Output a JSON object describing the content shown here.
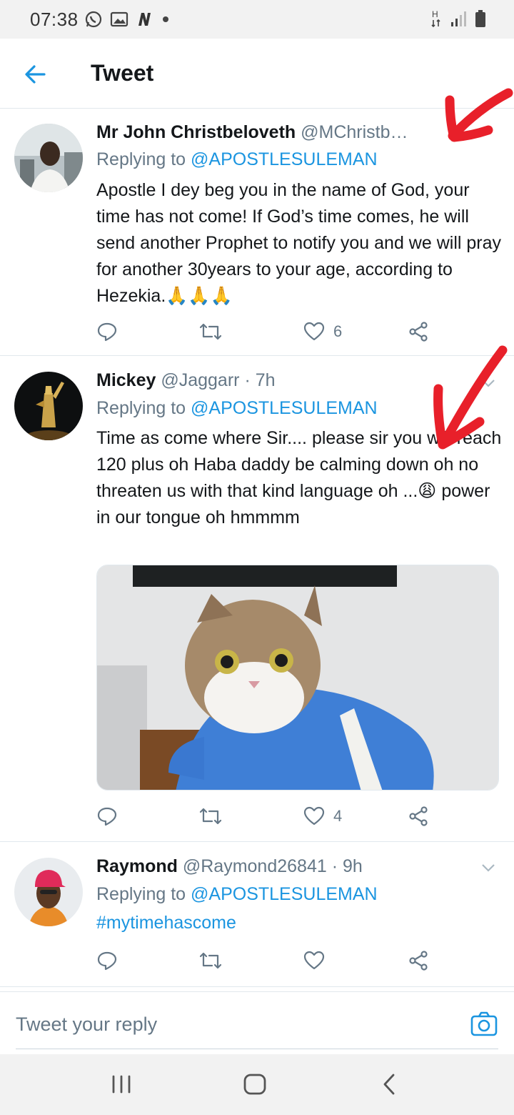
{
  "status_bar": {
    "time": "07:38",
    "left_icons": [
      "whatsapp-icon",
      "gallery-icon",
      "n-app-icon",
      "dot-icon"
    ],
    "right_icons": [
      "h-signal-icon",
      "signal-bars-icon",
      "battery-icon"
    ]
  },
  "header": {
    "title": "Tweet",
    "back_icon": "back-arrow-icon"
  },
  "tweets": [
    {
      "name": "Mr John Christbeloveth",
      "handle": "@MChristb…",
      "time": "",
      "replying_prefix": "Replying to ",
      "replying_to": "@APOSTLESULEMAN",
      "text": "Apostle I dey beg you in the name of God, your time has not come! If God’s time comes, he will send another Prophet to notify you and we will pray for another 30years to your age, according to Hezekia.🙏🙏🙏",
      "likes": "6"
    },
    {
      "name": "Mickey",
      "handle": "@Jaggarr",
      "time": "· 7h",
      "replying_prefix": "Replying to ",
      "replying_to": "@APOSTLESULEMAN",
      "text": "Time as come where Sir.... please sir you will reach 120 plus oh Haba daddy be calming down oh no threaten us with that kind language oh ...😩 power in our tongue oh hmmmm",
      "likes": "4",
      "media": "cat-photo"
    },
    {
      "name": "Raymond",
      "handle": "@Raymond26841",
      "time": "· 9h",
      "replying_prefix": "Replying to ",
      "replying_to": "@APOSTLESULEMAN",
      "text": "#mytimehascome",
      "likes": ""
    }
  ],
  "reply_bar": {
    "placeholder": "Tweet your reply",
    "icon": "camera-icon"
  },
  "nav_bar": {
    "buttons": [
      "recents-button",
      "home-button",
      "back-button"
    ]
  },
  "colors": {
    "accent": "#1b95e0",
    "secondary_text": "#657786",
    "annotation_red": "#e8202a"
  }
}
